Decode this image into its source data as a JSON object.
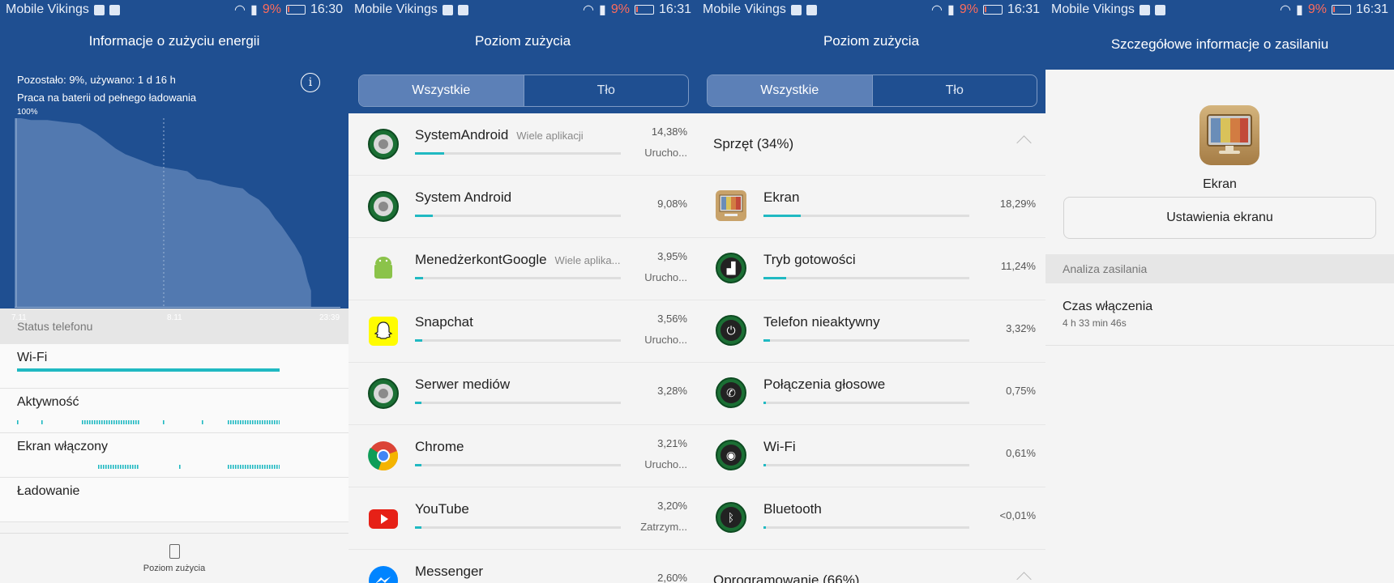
{
  "status_bar": [
    {
      "carrier": "Mobile Vikings",
      "battery_pct": "9%",
      "time": "16:30"
    },
    {
      "carrier": "Mobile Vikings",
      "battery_pct": "9%",
      "time": "16:31"
    },
    {
      "carrier": "Mobile Vikings",
      "battery_pct": "9%",
      "time": "16:31"
    },
    {
      "carrier": "Mobile Vikings",
      "battery_pct": "9%",
      "time": "16:31"
    }
  ],
  "screen1": {
    "title": "Informacje o zużyciu energii",
    "remaining": "Pozostało: 9%, używano: 1 d 16 h",
    "subtitle": "Praca na baterii od pełnego ładowania",
    "info_icon": "i",
    "chart_data": {
      "type": "area",
      "title": "",
      "xlabel": "",
      "ylabel": "",
      "y_top_label": "100%",
      "x_tick_labels": [
        "7.11",
        "8.11",
        "23:39"
      ],
      "ylim": [
        0,
        100
      ],
      "x": [
        0,
        0.02,
        0.05,
        0.1,
        0.15,
        0.2,
        0.25,
        0.28,
        0.31,
        0.34,
        0.37,
        0.4,
        0.43,
        0.46,
        0.5,
        0.53,
        0.56,
        0.6,
        0.63,
        0.66,
        0.7,
        0.72,
        0.75,
        0.78,
        0.8,
        0.82,
        0.84,
        0.86,
        0.88,
        0.89,
        0.9,
        0.91,
        0.91
      ],
      "values": [
        100,
        100,
        99,
        99,
        98,
        97,
        92,
        88,
        84,
        81,
        79,
        77,
        75,
        74,
        73,
        72,
        68,
        67,
        65,
        64,
        63,
        60,
        57,
        52,
        47,
        43,
        38,
        33,
        27,
        21,
        14,
        9,
        0
      ]
    },
    "status_header": "Status telefonu",
    "rows": [
      {
        "label": "Wi-Fi"
      },
      {
        "label": "Aktywność"
      },
      {
        "label": "Ekran włączony"
      },
      {
        "label": "Ładowanie"
      }
    ],
    "bottom_label": "Poziom zużycia"
  },
  "screen2": {
    "title": "Poziom zużycia",
    "tabs": [
      "Wszystkie",
      "Tło"
    ],
    "apps": [
      {
        "name": "SystemAndroid",
        "sub": "Wiele aplikacji",
        "pct": "14,38%",
        "status": "Urucho...",
        "level": 14.38,
        "icon": "android-system-icon",
        "color": "#2c8f3e"
      },
      {
        "name": "System Android",
        "sub": "",
        "pct": "9,08%",
        "status": "",
        "level": 9.08,
        "icon": "android-system-icon",
        "color": "#2c8f3e"
      },
      {
        "name": "MenedżerkontGoogle",
        "sub": "Wiele aplika...",
        "pct": "3,95%",
        "status": "Urucho...",
        "level": 3.95,
        "icon": "android-robot-icon",
        "color": "#8bc34a"
      },
      {
        "name": "Snapchat",
        "sub": "",
        "pct": "3,56%",
        "status": "Urucho...",
        "level": 3.56,
        "icon": "snapchat-ghost-icon",
        "color": "#fffc00"
      },
      {
        "name": "Serwer mediów",
        "sub": "",
        "pct": "3,28%",
        "status": "",
        "level": 3.28,
        "icon": "android-system-icon",
        "color": "#2c8f3e"
      },
      {
        "name": "Chrome",
        "sub": "",
        "pct": "3,21%",
        "status": "Urucho...",
        "level": 3.21,
        "icon": "chrome-icon",
        "color": "#db4437"
      },
      {
        "name": "YouTube",
        "sub": "",
        "pct": "3,20%",
        "status": "Zatrzym...",
        "level": 3.2,
        "icon": "youtube-icon",
        "color": "#e62117"
      },
      {
        "name": "Messenger",
        "sub": "",
        "pct": "2,60%",
        "status": "",
        "level": 2.6,
        "icon": "messenger-icon",
        "color": "#0084ff"
      }
    ]
  },
  "screen3": {
    "title": "Poziom zużycia",
    "tabs": [
      "Wszystkie",
      "Tło"
    ],
    "section1": "Sprzęt (34%)",
    "section2": "Oprogramowanie (66%)",
    "items": [
      {
        "name": "Ekran",
        "pct": "18,29%",
        "level": 18.29,
        "icon": "screen-icon"
      },
      {
        "name": "Tryb gotowości",
        "pct": "11,24%",
        "level": 11.24,
        "icon": "signal-icon"
      },
      {
        "name": "Telefon nieaktywny",
        "pct": "3,32%",
        "level": 3.32,
        "icon": "power-icon"
      },
      {
        "name": "Połączenia głosowe",
        "pct": "0,75%",
        "level": 0.75,
        "icon": "phone-call-icon"
      },
      {
        "name": "Wi-Fi",
        "pct": "0,61%",
        "level": 0.61,
        "icon": "wifi-icon"
      },
      {
        "name": "Bluetooth",
        "pct": "<0,01%",
        "level": 0.0,
        "icon": "bluetooth-icon"
      }
    ]
  },
  "screen4": {
    "title": "Szczegółowe informacje o zasilaniu",
    "item_name": "Ekran",
    "button": "Ustawienia ekranu",
    "section": "Analiza zasilania",
    "row_title": "Czas włączenia",
    "row_value": "4 h 33 min 46s"
  }
}
